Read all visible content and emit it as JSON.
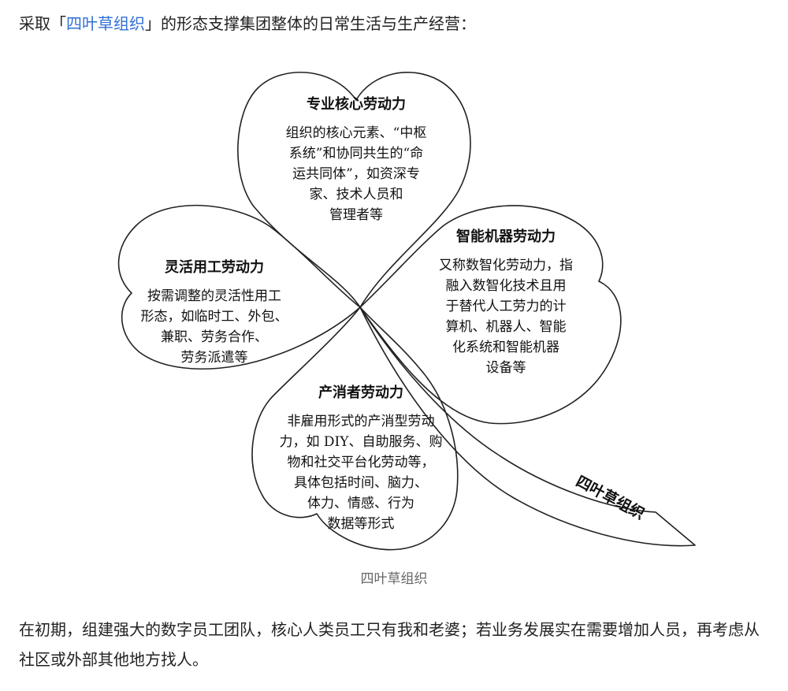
{
  "intro": {
    "prefix": "采取「",
    "link": "四叶草组织",
    "suffix": "」的形态支撑集团整体的日常生活与生产经营："
  },
  "diagram": {
    "leaves": {
      "top": {
        "title": "专业核心劳动力",
        "body": "组织的核心元素、“中枢\n系统”和协同共生的“命\n运共同体”，如资深专\n家、技术人员和\n管理者等"
      },
      "right": {
        "title": "智能机器劳动力",
        "body": "又称数智化劳动力，指\n融入数智化技术且用\n于替代人工劳力的计\n算机、机器人、智能\n化系统和智能机器\n设备等"
      },
      "left": {
        "title": "灵活用工劳动力",
        "body": "按需调整的灵活性用工\n形态，如临时工、外包、\n兼职、劳务合作、\n劳务派遣等"
      },
      "bottom": {
        "title": "产消者劳动力",
        "body": "非雇用形式的产消型劳动\n力，如 DIY、自助服务、购\n物和社交平台化劳动等，\n具体包括时间、脑力、\n体力、情感、行为\n数据等形式"
      }
    },
    "stem_label": "四叶草组织"
  },
  "caption": "四叶草组织",
  "paragraph": "在初期，组建强大的数字员工团队，核心人类员工只有我和老婆；若业务发展实在需要增加人员，再考虑从社区或外部其他地方找人。"
}
